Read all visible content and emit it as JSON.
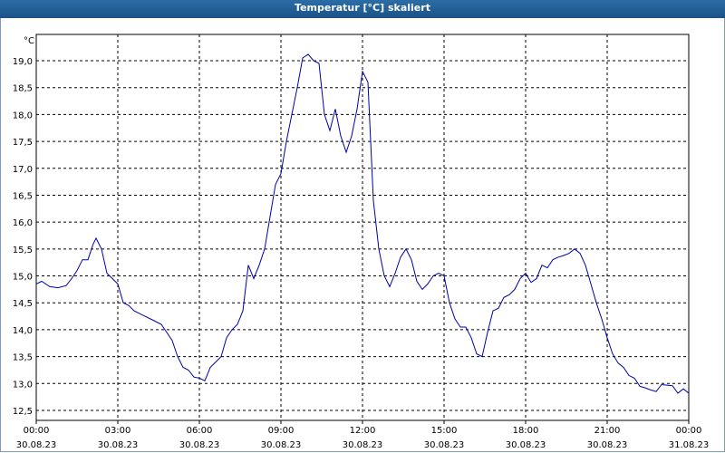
{
  "window": {
    "title": "Temperatur [°C] skaliert"
  },
  "chart_data": {
    "type": "line",
    "title": "Temperatur [°C] skaliert",
    "unit_label": "°C",
    "xlabel": "",
    "ylabel": "",
    "ylim": [
      12.5,
      19.5
    ],
    "yticks": [
      "12,5",
      "13,0",
      "13,5",
      "14,0",
      "14,5",
      "15,0",
      "15,5",
      "16,0",
      "16,5",
      "17,0",
      "17,5",
      "18,0",
      "18,5",
      "19,0"
    ],
    "xticks": [
      {
        "time": "00:00",
        "date": "30.08.23"
      },
      {
        "time": "03:00",
        "date": "30.08.23"
      },
      {
        "time": "06:00",
        "date": "30.08.23"
      },
      {
        "time": "09:00",
        "date": "30.08.23"
      },
      {
        "time": "12:00",
        "date": "30.08.23"
      },
      {
        "time": "15:00",
        "date": "30.08.23"
      },
      {
        "time": "18:00",
        "date": "30.08.23"
      },
      {
        "time": "21:00",
        "date": "30.08.23"
      },
      {
        "time": "00:00",
        "date": "31.08.23"
      }
    ],
    "grid": true,
    "colors": {
      "line": "#0000aa",
      "grid": "#000000",
      "title_bar": "#1f5a93"
    },
    "series": [
      {
        "x_hours": [
          0,
          0.2,
          0.5,
          0.8,
          1.1,
          1.3,
          1.5,
          1.7,
          1.9,
          2.1,
          2.2,
          2.4,
          2.6,
          2.8,
          3.0,
          3.2,
          3.4,
          3.6,
          3.8,
          4.0,
          4.2,
          4.4,
          4.6,
          4.8,
          5.0,
          5.2,
          5.4,
          5.6,
          5.8,
          6.0,
          6.2,
          6.4,
          6.6,
          6.8,
          7.0,
          7.2,
          7.4,
          7.6,
          7.8,
          8.0,
          8.2,
          8.4,
          8.6,
          8.8,
          9.0,
          9.2,
          9.4,
          9.6,
          9.8,
          10.0,
          10.2,
          10.4,
          10.6,
          10.8,
          11.0,
          11.2,
          11.4,
          11.6,
          11.8,
          12.0,
          12.2,
          12.4,
          12.6,
          12.8,
          13.0,
          13.2,
          13.4,
          13.6,
          13.8,
          14.0,
          14.2,
          14.4,
          14.6,
          14.8,
          15.0,
          15.2,
          15.4,
          15.6,
          15.8,
          16.0,
          16.2,
          16.4,
          16.6,
          16.8,
          17.0,
          17.2,
          17.4,
          17.6,
          17.8,
          18.0,
          18.2,
          18.4,
          18.6,
          18.8,
          19.0,
          19.2,
          19.4,
          19.6,
          19.8,
          20.0,
          20.2,
          20.4,
          20.6,
          20.8,
          21.0,
          21.2,
          21.4,
          21.6,
          21.8,
          22.0,
          22.2,
          22.4,
          22.6,
          22.8,
          23.0,
          23.2,
          23.4,
          23.6,
          23.8,
          24.0
        ],
        "values": [
          14.85,
          14.9,
          14.8,
          14.78,
          14.82,
          14.95,
          15.1,
          15.3,
          15.3,
          15.6,
          15.7,
          15.5,
          15.05,
          14.95,
          14.85,
          14.5,
          14.45,
          14.35,
          14.3,
          14.25,
          14.2,
          14.15,
          14.1,
          13.95,
          13.8,
          13.5,
          13.3,
          13.25,
          13.12,
          13.1,
          13.05,
          13.3,
          13.4,
          13.5,
          13.85,
          14.0,
          14.1,
          14.35,
          15.2,
          14.95,
          15.2,
          15.5,
          16.1,
          16.7,
          16.9,
          17.5,
          18.0,
          18.5,
          19.05,
          19.12,
          19.0,
          18.95,
          18.0,
          17.7,
          18.1,
          17.6,
          17.3,
          17.6,
          18.1,
          18.8,
          18.6,
          16.4,
          15.5,
          15.0,
          14.8,
          15.05,
          15.35,
          15.5,
          15.3,
          14.9,
          14.75,
          14.85,
          15.0,
          15.05,
          15.0,
          14.5,
          14.2,
          14.05,
          14.05,
          13.85,
          13.55,
          13.5,
          13.95,
          14.35,
          14.4,
          14.6,
          14.65,
          14.75,
          14.95,
          15.05,
          14.88,
          14.95,
          15.2,
          15.15,
          15.3,
          15.35,
          15.38,
          15.42,
          15.5,
          15.42,
          15.2,
          14.85,
          14.5,
          14.2,
          13.85,
          13.55,
          13.38,
          13.3,
          13.15,
          13.1,
          12.95,
          12.92,
          12.88,
          12.85,
          12.98,
          12.97,
          12.96,
          12.82,
          12.9,
          12.82
        ]
      }
    ]
  }
}
